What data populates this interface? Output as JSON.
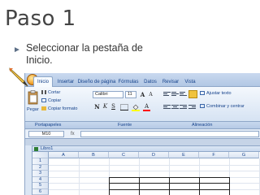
{
  "slide": {
    "title": "Paso 1",
    "bullet": "Seleccionar la pestaña de Inicio."
  },
  "tabs": [
    {
      "label": "Inicio",
      "active": true
    },
    {
      "label": "Insertar"
    },
    {
      "label": "Diseño de página"
    },
    {
      "label": "Fórmulas"
    },
    {
      "label": "Datos"
    },
    {
      "label": "Revisar"
    },
    {
      "label": "Vista"
    }
  ],
  "ribbon": {
    "clipboard": {
      "paste": "Pegar",
      "cut": "Cortar",
      "copy": "Copiar",
      "format_painter": "Copiar formato",
      "group_label": "Portapapeles"
    },
    "font": {
      "name": "Calibri",
      "size": "11",
      "bold": "N",
      "italic": "K",
      "underline": "S",
      "grow": "A",
      "shrink": "A",
      "color_letter": "A",
      "group_label": "Fuente"
    },
    "alignment": {
      "wrap_text": "Ajustar texto",
      "merge_center": "Combinar y centrar",
      "group_label": "Alineación"
    }
  },
  "formula_bar": {
    "name_box": "M10",
    "fx": "fx"
  },
  "workbook": {
    "title": "Libro1"
  },
  "grid": {
    "columns": [
      "A",
      "B",
      "C",
      "D",
      "E",
      "F",
      "G"
    ],
    "rows": [
      "1",
      "2",
      "3",
      "4",
      "5",
      "6"
    ]
  },
  "colors": {
    "ribbon_text": "#15428b",
    "office_button": "#f2a12b"
  }
}
